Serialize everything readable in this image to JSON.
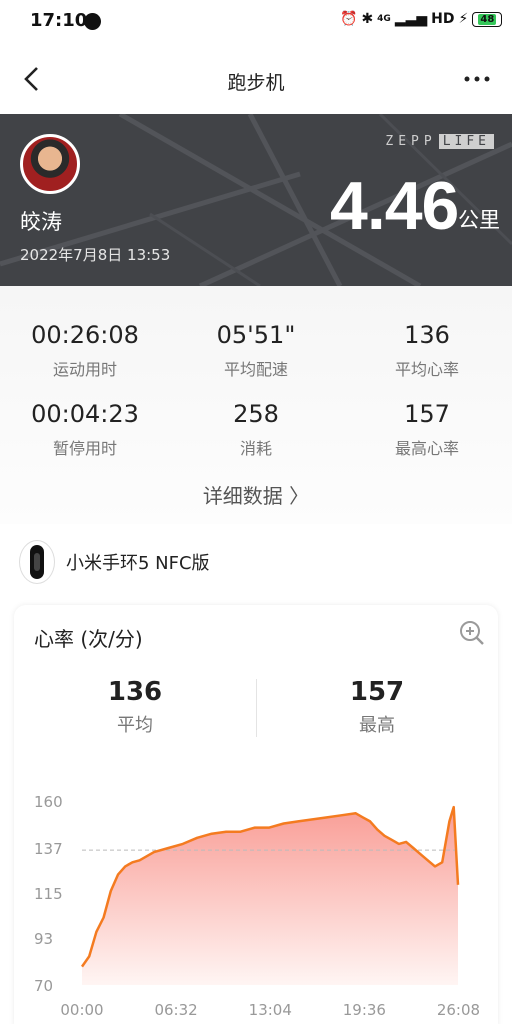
{
  "status_bar": {
    "time": "17:10",
    "network": "4G",
    "hd": "HD",
    "battery": "48"
  },
  "nav": {
    "title": "跑步机"
  },
  "hero": {
    "user_name": "皎涛",
    "date": "2022年7月8日 13:53",
    "brand_left": "ZEPP",
    "brand_right": "LIFE",
    "distance": "4.46",
    "distance_unit": "公里"
  },
  "stats": [
    {
      "value": "00:26:08",
      "label": "运动用时"
    },
    {
      "value": "05'51\"",
      "label": "平均配速"
    },
    {
      "value": "136",
      "label": "平均心率"
    },
    {
      "value": "00:04:23",
      "label": "暂停用时"
    },
    {
      "value": "258",
      "label": "消耗"
    },
    {
      "value": "157",
      "label": "最高心率"
    }
  ],
  "details_link": "详细数据 〉",
  "device": {
    "name": "小米手环5 NFC版"
  },
  "heart_rate": {
    "title": "心率 (次/分)",
    "avg_value": "136",
    "avg_label": "平均",
    "max_value": "157",
    "max_label": "最高"
  },
  "colors": {
    "line": "#f47b20",
    "fill_top": "#f8928a",
    "fill_bottom": "#fff4f2",
    "hero_bg": "#414347"
  },
  "chart_data": {
    "type": "area",
    "ylim": [
      70,
      160
    ],
    "y_ticks": [
      "160",
      "137",
      "115",
      "93",
      "70"
    ],
    "x_ticks": [
      "00:00",
      "06:32",
      "13:04",
      "19:36",
      "26:08"
    ],
    "avg_line": 136,
    "x_minutes": [
      0,
      0.5,
      1,
      1.5,
      2,
      2.5,
      3,
      3.5,
      4,
      5,
      6,
      7,
      8,
      9,
      10,
      11,
      12,
      13,
      14,
      15,
      16,
      17,
      18,
      19,
      19.5,
      20,
      20.5,
      21,
      21.5,
      22,
      22.5,
      23,
      23.5,
      24,
      24.5,
      25,
      25.5,
      25.8,
      26.1
    ],
    "values": [
      79,
      84,
      96,
      103,
      116,
      124,
      128,
      130,
      131,
      135,
      137,
      139,
      142,
      144,
      145,
      145,
      147,
      147,
      149,
      150,
      151,
      152,
      153,
      154,
      152,
      150,
      146,
      143,
      141,
      139,
      140,
      137,
      134,
      131,
      128,
      130,
      150,
      157,
      119
    ]
  }
}
